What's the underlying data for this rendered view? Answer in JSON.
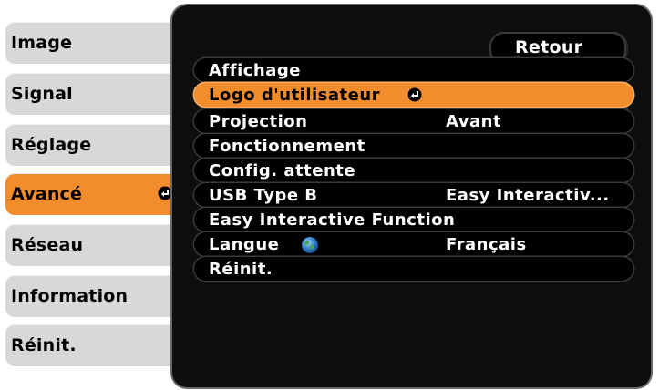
{
  "tabs": [
    {
      "label": "Image"
    },
    {
      "label": "Signal"
    },
    {
      "label": "Réglage"
    },
    {
      "label": "Avancé",
      "active": true
    },
    {
      "label": "Réseau"
    },
    {
      "label": "Information"
    },
    {
      "label": "Réinit."
    }
  ],
  "panel": {
    "back_label": "Retour",
    "items": [
      {
        "label": "Affichage",
        "value": ""
      },
      {
        "label": "Logo d'utilisateur",
        "value": "",
        "selected": true,
        "icon": "enter-icon"
      },
      {
        "label": "Projection",
        "value": "Avant"
      },
      {
        "label": "Fonctionnement",
        "value": ""
      },
      {
        "label": "Config. attente",
        "value": ""
      },
      {
        "label": "USB Type B",
        "value": "Easy Interactiv..."
      },
      {
        "label": "Easy Interactive Function",
        "value": ""
      },
      {
        "label": "Langue",
        "value": "Français",
        "icon": "globe-icon"
      },
      {
        "label": "Réinit.",
        "value": ""
      }
    ]
  },
  "colors": {
    "accent": "#f28d2d",
    "tab_bg": "#d8d8d8",
    "panel_bg": "#0e0e0e"
  }
}
